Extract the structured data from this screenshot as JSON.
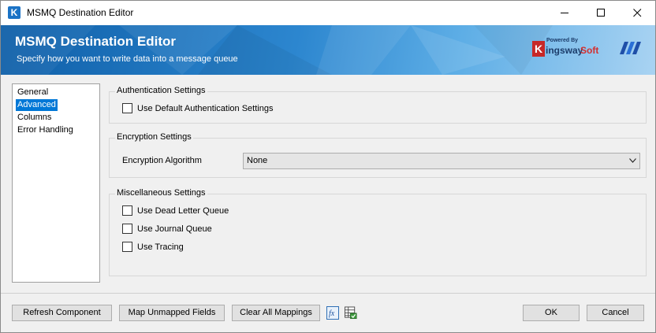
{
  "window": {
    "title": "MSMQ Destination Editor"
  },
  "banner": {
    "title": "MSMQ Destination Editor",
    "subtitle": "Specify how you want to write data into a message queue",
    "logo_powered_by": "Powered By",
    "logo_k": "K",
    "logo_name_part1": "ingsway",
    "logo_name_part2": "Soft"
  },
  "nav": {
    "items": [
      {
        "label": "General",
        "selected": false
      },
      {
        "label": "Advanced",
        "selected": true
      },
      {
        "label": "Columns",
        "selected": false
      },
      {
        "label": "Error Handling",
        "selected": false
      }
    ]
  },
  "authentication": {
    "title": "Authentication Settings",
    "use_default_label": "Use Default Authentication Settings",
    "use_default_checked": false
  },
  "encryption": {
    "title": "Encryption Settings",
    "algorithm_label": "Encryption Algorithm",
    "algorithm_value": "None"
  },
  "misc": {
    "title": "Miscellaneous Settings",
    "dead_letter_label": "Use Dead Letter Queue",
    "journal_label": "Use Journal Queue",
    "tracing_label": "Use Tracing"
  },
  "footer": {
    "refresh_label": "Refresh Component",
    "map_unmapped_label": "Map Unmapped Fields",
    "clear_mappings_label": "Clear All Mappings",
    "fx_glyph": "fx",
    "ok_label": "OK",
    "cancel_label": "Cancel"
  },
  "colors": {
    "accent": "#0078d7",
    "banner_dark": "#0f5fa8",
    "banner_light": "#a9d3f2"
  },
  "icons": [
    "app-k-icon",
    "minimize-icon",
    "maximize-icon",
    "close-icon",
    "chevron-down-icon",
    "fx-expression-icon",
    "grid-check-icon",
    "dotnet-logo-icon"
  ]
}
